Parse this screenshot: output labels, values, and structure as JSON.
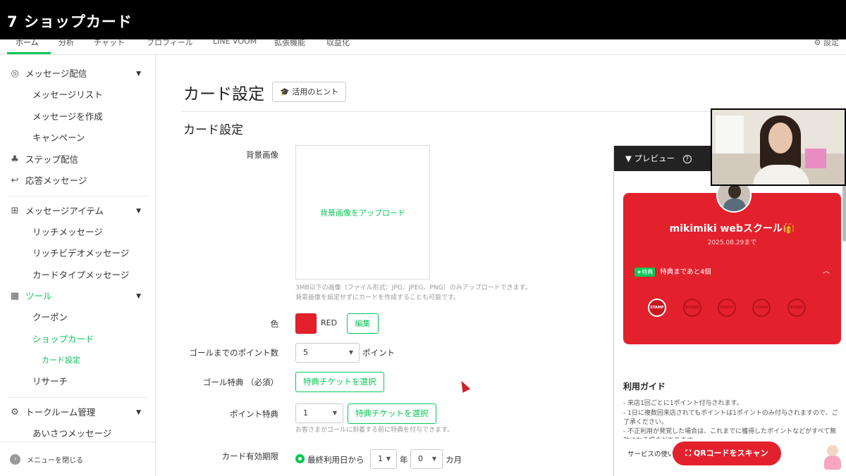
{
  "video_title": "7 ショップカード",
  "top_nav": {
    "tabs": [
      "ホーム",
      "分析",
      "チャット",
      "プロフィール",
      "LINE VOOM",
      "拡張機能",
      "収益化"
    ],
    "settings": "設定"
  },
  "sidebar": {
    "message_delivery": "メッセージ配信",
    "message_list": "メッセージリスト",
    "create_message": "メッセージを作成",
    "campaign": "キャンペーン",
    "step_delivery": "ステップ配信",
    "auto_reply": "応答メッセージ",
    "message_items": "メッセージアイテム",
    "rich_message": "リッチメッセージ",
    "rich_video": "リッチビデオメッセージ",
    "card_type": "カードタイプメッセージ",
    "tools": "ツール",
    "coupon": "クーポン",
    "shop_card": "ショップカード",
    "card_settings": "カード設定",
    "research": "リサーチ",
    "talk_room": "トークルーム管理",
    "greeting": "あいさつメッセージ",
    "close_menu": "メニューを閉じる"
  },
  "main": {
    "page_title": "カード設定",
    "hint_button": "活用のヒント",
    "section_title": "カード設定",
    "background_label": "背景画像",
    "upload_text": "背景画像をアップロード",
    "help1": "3MB以下の画像（ファイル形式：JPG、JPEG、PNG）のみアップロードできます。",
    "help2": "背景画像を設定せずにカードを作成することも可能です。",
    "color_label": "色",
    "color_name": "RED",
    "edit_button": "編集",
    "goal_points_label": "ゴールまでのポイント数",
    "goal_points_value": "5",
    "points_unit": "ポイント",
    "goal_benefit_label": "ゴール特典 （必須）",
    "select_ticket": "特典チケットを選択",
    "point_benefit_label": "ポイント特典",
    "point_benefit_value": "1",
    "point_benefit_help": "お客さまがゴールに到着する前に特典を付与できます。",
    "expiry_label": "カード有効期限",
    "expiry_option": "最終利用日から",
    "expiry_years": "1",
    "year_unit": "年",
    "expiry_months": "0",
    "month_unit": "カ月"
  },
  "preview": {
    "header": "プレビュー",
    "card_title": "mikimiki webスクール🎁",
    "card_date": "2025.08.29まで",
    "benefit_badge": "★特典",
    "benefit_text": "特典まであと4個",
    "stamp_label": "STAMP",
    "guide_title": "利用ガイド",
    "guide1": "- 来店1回ごとに1ポイント付与されます。",
    "guide2": "- 1日に複数回来店されてもポイントは1ポイントのみ付与されますので、ご了承ください。",
    "guide3": "- 不正利用が発覚した場合は、これまでに獲得したポイントなどがすべて無効になる場合があります。",
    "service_link": "サービスの使い",
    "qr_button": "QRコードをスキャン"
  }
}
